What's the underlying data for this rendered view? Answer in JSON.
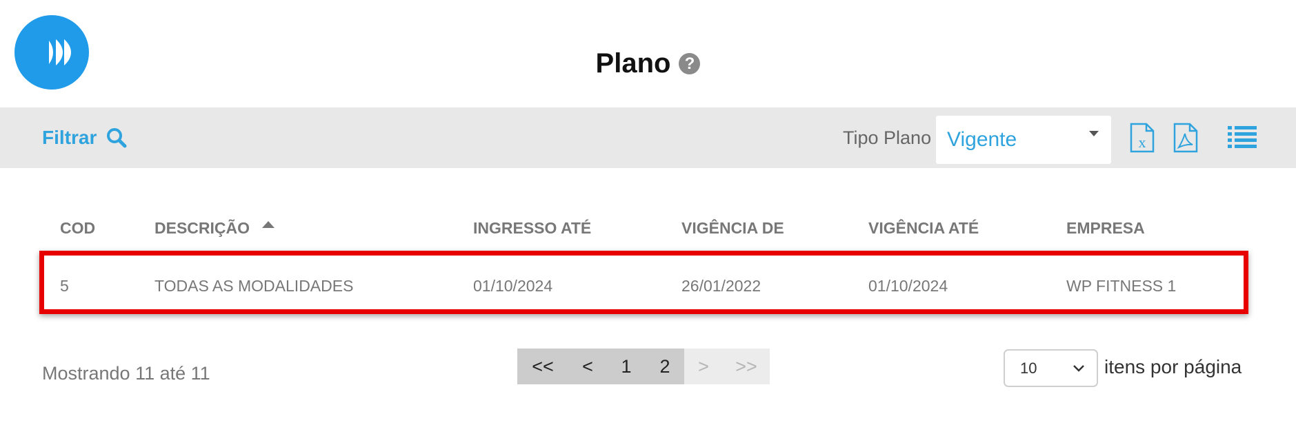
{
  "header": {
    "title": "Plano",
    "help_glyph": "?",
    "logo_icon": "fast-forward-logo-icon"
  },
  "toolbar": {
    "filter_label": "Filtrar",
    "filter_icon": "search-icon",
    "tipo_plano_label": "Tipo Plano",
    "tipo_plano_value": "Vigente",
    "icons": [
      "excel-export-icon",
      "pdf-export-icon",
      "list-view-icon"
    ]
  },
  "table": {
    "columns": [
      "COD",
      "DESCRIÇÃO",
      "INGRESSO ATÉ",
      "VIGÊNCIA DE",
      "VIGÊNCIA ATÉ",
      "EMPRESA"
    ],
    "sorted_column": "DESCRIÇÃO",
    "sort_direction": "ascending",
    "rows": [
      [
        "5",
        "TODAS AS MODALIDADES",
        "01/10/2024",
        "26/01/2022",
        "01/10/2024",
        "WP FITNESS 1"
      ]
    ],
    "highlight_color": "#e80000"
  },
  "footer": {
    "showing_text": "Mostrando 11 até 11",
    "pages": [
      {
        "label": "<<",
        "state": "active"
      },
      {
        "label": "<",
        "state": "active"
      },
      {
        "label": "1",
        "state": "active"
      },
      {
        "label": "2",
        "state": "active"
      },
      {
        "label": ">",
        "state": "disabled"
      },
      {
        "label": ">>",
        "state": "disabled"
      }
    ],
    "per_page_value": "10",
    "per_page_label": "itens por página"
  },
  "colors": {
    "accent": "#2fa3dd",
    "logo": "#1f9bea",
    "toolbar_bg": "#e8e8e8"
  }
}
